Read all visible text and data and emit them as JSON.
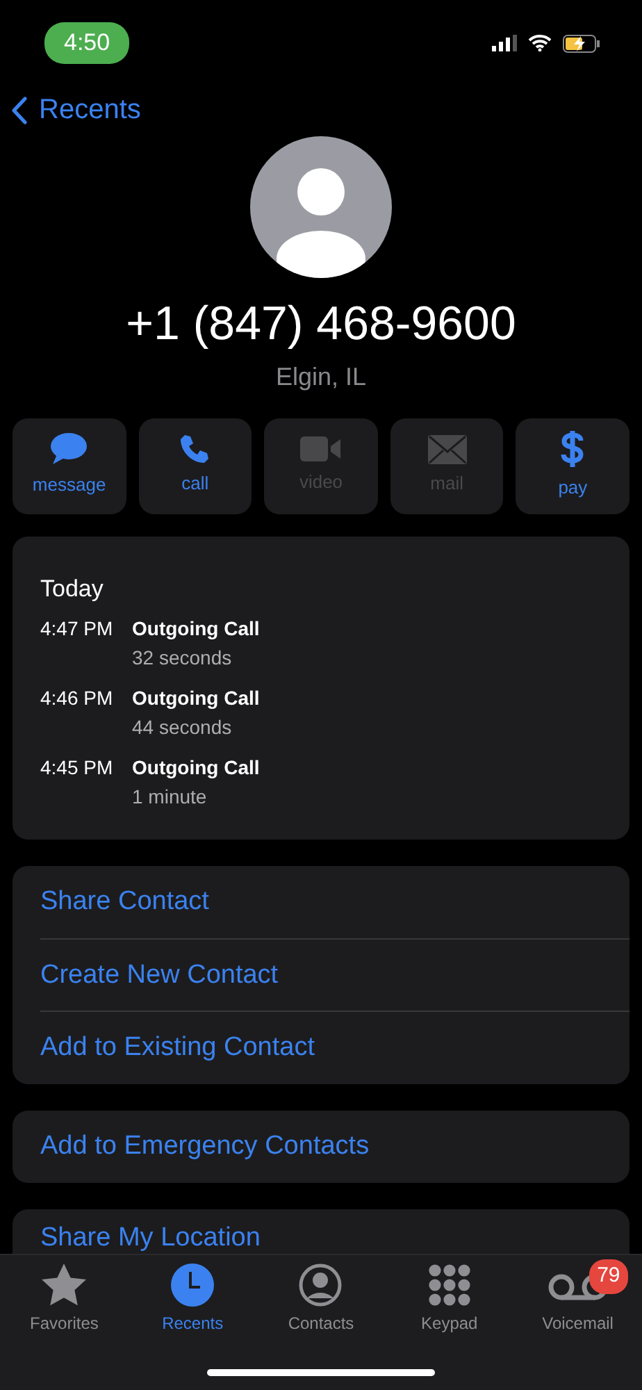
{
  "status_bar": {
    "time": "4:50"
  },
  "nav": {
    "back": "Recents"
  },
  "contact": {
    "number": "+1 (847) 468-9600",
    "location": "Elgin, IL"
  },
  "actions": [
    {
      "label": "message",
      "disabled": false
    },
    {
      "label": "call",
      "disabled": false
    },
    {
      "label": "video",
      "disabled": true
    },
    {
      "label": "mail",
      "disabled": true
    },
    {
      "label": "pay",
      "disabled": false
    }
  ],
  "history": {
    "heading": "Today",
    "calls": [
      {
        "time": "4:47 PM",
        "type": "Outgoing Call",
        "duration": "32 seconds"
      },
      {
        "time": "4:46 PM",
        "type": "Outgoing Call",
        "duration": "44 seconds"
      },
      {
        "time": "4:45 PM",
        "type": "Outgoing Call",
        "duration": "1 minute"
      }
    ]
  },
  "option_groups": [
    [
      "Share Contact",
      "Create New Contact",
      "Add to Existing Contact"
    ],
    [
      "Add to Emergency Contacts"
    ],
    [
      "Share My Location"
    ]
  ],
  "tab_bar": [
    {
      "label": "Favorites",
      "selected": false
    },
    {
      "label": "Recents",
      "selected": true
    },
    {
      "label": "Contacts",
      "selected": false
    },
    {
      "label": "Keypad",
      "selected": false
    },
    {
      "label": "Voicemail",
      "selected": false,
      "badge": "79"
    }
  ]
}
